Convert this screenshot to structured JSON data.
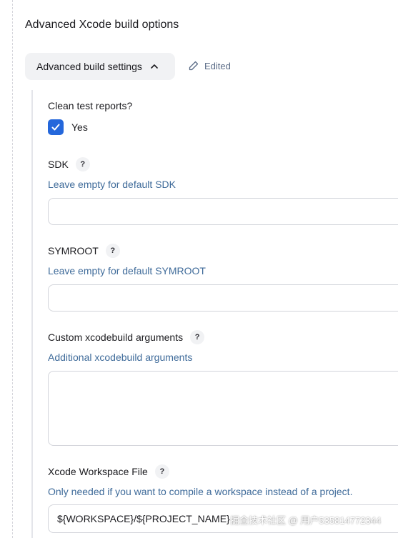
{
  "section": {
    "title": "Advanced Xcode build options"
  },
  "advanced": {
    "toggle_label": "Advanced build settings",
    "edited_label": "Edited"
  },
  "clean_reports": {
    "label": "Clean test reports?",
    "option_label": "Yes",
    "checked": true
  },
  "sdk": {
    "label": "SDK",
    "help": "?",
    "hint": "Leave empty for default SDK",
    "value": ""
  },
  "symroot": {
    "label": "SYMROOT",
    "help": "?",
    "hint": "Leave empty for default SYMROOT",
    "value": ""
  },
  "custom_args": {
    "label": "Custom xcodebuild arguments",
    "help": "?",
    "hint": "Additional xcodebuild arguments",
    "value": ""
  },
  "workspace": {
    "label": "Xcode Workspace File",
    "help": "?",
    "hint": "Only needed if you want to compile a workspace instead of a project.",
    "value": "${WORKSPACE}/${PROJECT_NAME}"
  },
  "watermark": "掘金技术社区 @ 用户535814772344",
  "colors": {
    "accent": "#2467db",
    "hint": "#3f6b9a",
    "border": "#d3d5db"
  }
}
